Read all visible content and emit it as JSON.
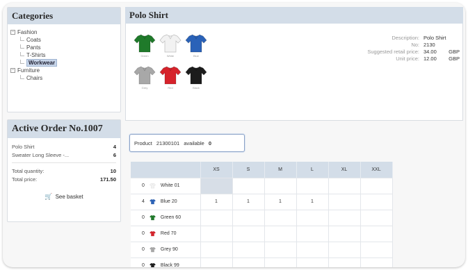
{
  "categories": {
    "title": "Categories",
    "tree": {
      "fashion": "Fashion",
      "fashion_children": [
        "Coats",
        "Pants",
        "T-Shirts",
        "Workwear"
      ],
      "furniture": "Furniture",
      "furniture_children": [
        "Chairs"
      ]
    }
  },
  "order": {
    "title": "Active Order No.1007",
    "items": [
      {
        "name": "Polo Shirt",
        "qty": "4"
      },
      {
        "name": "Sweater Long Sleeve -...",
        "qty": "6"
      }
    ],
    "total_quantity_label": "Total quantity:",
    "total_quantity": "10",
    "total_price_label": "Total price:",
    "total_price": "171.50",
    "basket_label": "See basket"
  },
  "product": {
    "title": "Polo Shirt",
    "shirts": [
      {
        "color": "#1f7a2a",
        "label": "Green"
      },
      {
        "color": "#f2f2f2",
        "label": "White"
      },
      {
        "color": "#2a62b8",
        "label": "Blue"
      },
      {
        "color": "#a8a8a8",
        "label": "Grey"
      },
      {
        "color": "#d6232b",
        "label": "Red"
      },
      {
        "color": "#1c1c1c",
        "label": "Black"
      }
    ],
    "description_label": "Description:",
    "description": "Polo Shirt",
    "no_label": "No:",
    "no": "2130",
    "retail_label": "Suggested retail price:",
    "retail_value": "34.00",
    "unit_label": "Unit price:",
    "unit_value": "12.00",
    "currency": "GBP"
  },
  "availability": {
    "product_label": "Product",
    "product_code": "21300101",
    "available_label": "available",
    "available_count": "0"
  },
  "grid": {
    "sizes": [
      "XS",
      "S",
      "M",
      "L",
      "XL",
      "XXL"
    ],
    "rows": [
      {
        "count": "0",
        "label": "White 01",
        "color": "#f2f2f2",
        "cells": [
          "",
          "",
          "",
          "",
          "",
          ""
        ]
      },
      {
        "count": "4",
        "label": "Blue 20",
        "color": "#2a62b8",
        "cells": [
          "1",
          "1",
          "1",
          "1",
          "",
          ""
        ]
      },
      {
        "count": "0",
        "label": "Green 60",
        "color": "#1f7a2a",
        "cells": [
          "",
          "",
          "",
          "",
          "",
          ""
        ]
      },
      {
        "count": "0",
        "label": "Red 70",
        "color": "#d6232b",
        "cells": [
          "",
          "",
          "",
          "",
          "",
          ""
        ]
      },
      {
        "count": "0",
        "label": "Grey 90",
        "color": "#a8a8a8",
        "cells": [
          "",
          "",
          "",
          "",
          "",
          ""
        ]
      },
      {
        "count": "0",
        "label": "Black 99",
        "color": "#1c1c1c",
        "cells": [
          "",
          "",
          "",
          "",
          "",
          ""
        ]
      }
    ]
  }
}
